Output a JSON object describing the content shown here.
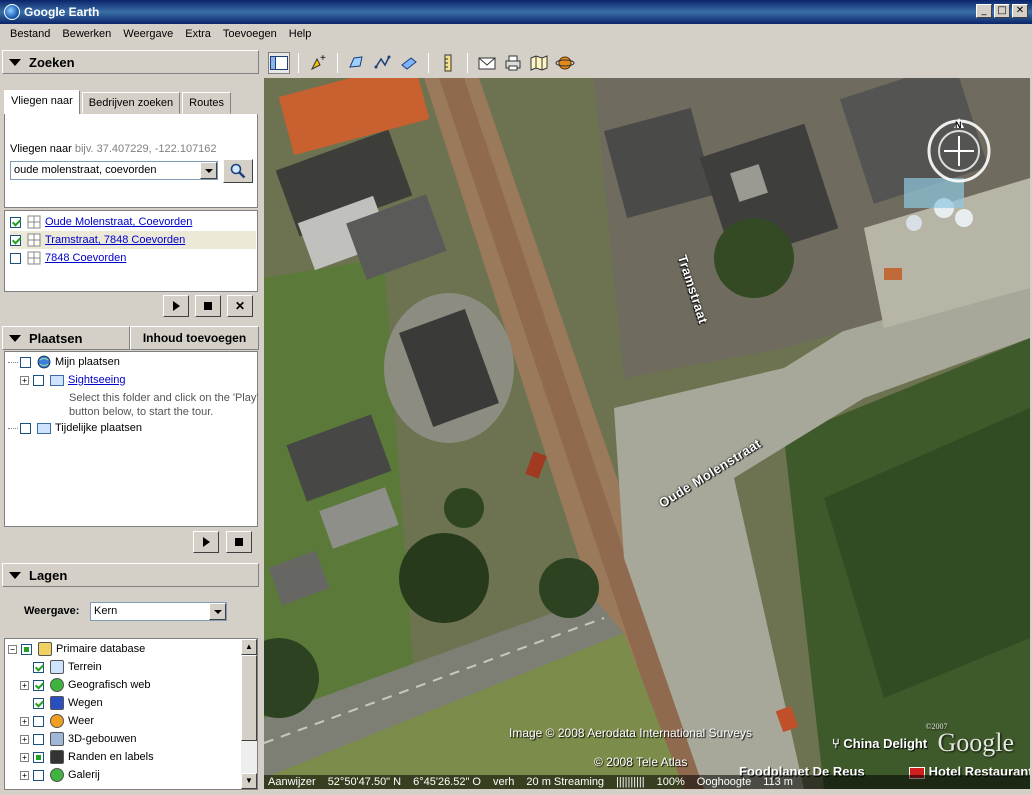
{
  "window": {
    "title": "Google Earth"
  },
  "menu": [
    "Bestand",
    "Bewerken",
    "Weergave",
    "Extra",
    "Toevoegen",
    "Help"
  ],
  "search_panel": {
    "title": "Zoeken",
    "tabs": [
      "Vliegen naar",
      "Bedrijven zoeken",
      "Routes"
    ],
    "hint_label": "Vliegen naar",
    "hint_example": "bijv. 37.407229, -122.107162",
    "input_value": "oude molenstraat, coevorden",
    "results": [
      {
        "label": "Oude Molenstraat, Coevorden",
        "checked": true
      },
      {
        "label": "Tramstraat, 7848 Coevorden",
        "checked": true
      },
      {
        "label": "7848 Coevorden",
        "checked": false
      }
    ]
  },
  "places_panel": {
    "title": "Plaatsen",
    "add_button": "Inhoud toevoegen",
    "items": {
      "my_places": "Mijn plaatsen",
      "sightseeing": "Sightseeing",
      "sightseeing_desc_1": "Select this folder and click on the 'Play'",
      "sightseeing_desc_2": "button below, to start the tour.",
      "temporary": "Tijdelijke plaatsen"
    }
  },
  "layers_panel": {
    "title": "Lagen",
    "view_label": "Weergave:",
    "view_value": "Kern",
    "items": [
      {
        "label": "Primaire database",
        "state": "partial",
        "icon": "database-icon"
      },
      {
        "label": "Terrein",
        "state": "on",
        "icon": "folder-icon"
      },
      {
        "label": "Geografisch web",
        "state": "on",
        "icon": "star-icon"
      },
      {
        "label": "Wegen",
        "state": "on",
        "icon": "shield-icon"
      },
      {
        "label": "Weer",
        "state": "off",
        "icon": "sun-icon"
      },
      {
        "label": "3D-gebouwen",
        "state": "off",
        "icon": "building-icon"
      },
      {
        "label": "Randen en labels",
        "state": "partial",
        "icon": "flag-icon"
      },
      {
        "label": "Galerij",
        "state": "off",
        "icon": "star-icon"
      }
    ]
  },
  "map": {
    "street_labels": [
      "Tramstraat",
      "Oude Molenstraat"
    ],
    "credits": [
      "Image © 2008 Aerodata International Surveys",
      "© 2008 Tele Atlas"
    ],
    "poi_labels": [
      "China Delight",
      "Foodplanet De Reus",
      "Hotel Restaurant",
      "Ooghoogte"
    ],
    "logo": "Google",
    "logo_year": "©2007",
    "status": {
      "pointer_label": "Aanwijzer",
      "lat": "52°50'47.50\" N",
      "lon": "6°45'26.52\" O",
      "elev": "verh",
      "streaming": "20 m Streaming",
      "bars": "||||||||||",
      "percent": "100%",
      "eye_alt": "113 m"
    }
  },
  "colors": {
    "title_bar": "#0a246a",
    "link": "#0000cc",
    "check": "#21a121"
  }
}
